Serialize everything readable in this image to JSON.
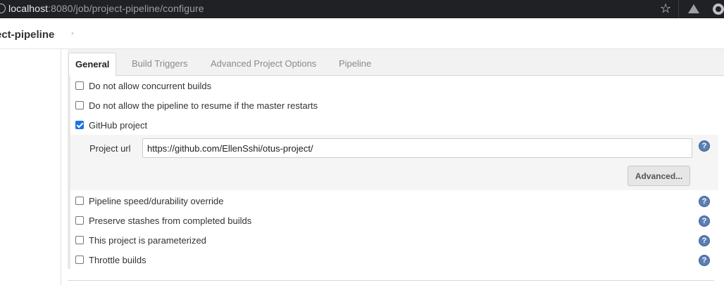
{
  "browser": {
    "url_host": "localhost",
    "url_rest": ":8080/job/project-pipeline/configure",
    "icons": [
      "info-icon",
      "star-icon",
      "drive-icon",
      "extension-icon"
    ]
  },
  "breadcrumb": {
    "project": "ect-pipeline",
    "arrow": "›"
  },
  "tabs": [
    {
      "label": "General",
      "active": true
    },
    {
      "label": "Build Triggers",
      "active": false
    },
    {
      "label": "Advanced Project Options",
      "active": false
    },
    {
      "label": "Pipeline",
      "active": false
    }
  ],
  "options": {
    "concurrent": {
      "label": "Do not allow concurrent builds",
      "checked": false
    },
    "resume": {
      "label": "Do not allow the pipeline to resume if the master restarts",
      "checked": false
    },
    "github": {
      "label": "GitHub project",
      "checked": true
    },
    "speed": {
      "label": "Pipeline speed/durability override",
      "checked": false
    },
    "stashes": {
      "label": "Preserve stashes from completed builds",
      "checked": false
    },
    "parameterized": {
      "label": "This project is parameterized",
      "checked": false
    },
    "throttle": {
      "label": "Throttle builds",
      "checked": false
    }
  },
  "github_project": {
    "url_label": "Project url",
    "url_value": "https://github.com/EllenSshi/otus-project/",
    "advanced_label": "Advanced..."
  },
  "help_glyph": "?",
  "colors": {
    "chrome_bg": "#202124",
    "checkbox_checked": "#1a73e8",
    "help_icon": "#5b7fb5"
  }
}
